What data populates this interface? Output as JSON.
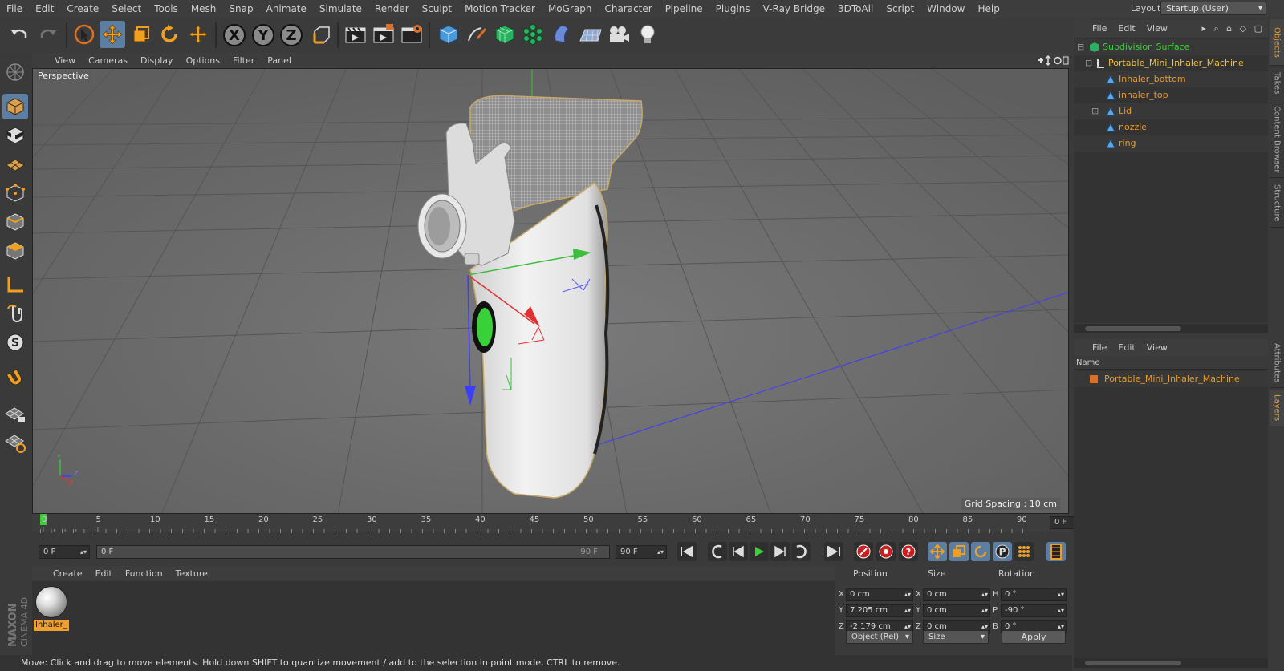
{
  "menubar": {
    "items": [
      "File",
      "Edit",
      "Create",
      "Select",
      "Tools",
      "Mesh",
      "Snap",
      "Animate",
      "Simulate",
      "Render",
      "Sculpt",
      "Motion Tracker",
      "MoGraph",
      "Character",
      "Pipeline",
      "Plugins",
      "V-Ray Bridge",
      "3DToAll",
      "Script",
      "Window",
      "Help"
    ],
    "layout_label": "Layout:",
    "layout_value": "Startup (User)"
  },
  "toolbar": {
    "icons": [
      "undo-icon",
      "redo-icon",
      "live-selection-icon",
      "move-icon",
      "scale-icon",
      "rotate-icon",
      "recent-tool-icon",
      "x-axis-lock",
      "y-axis-lock",
      "z-axis-lock",
      "coordinate-system-icon",
      "render-view-icon",
      "render-picture-viewer-icon",
      "render-settings-icon",
      "cube-primitive-icon",
      "pen-spline-icon",
      "subdivision-surface-icon",
      "cloner-icon",
      "deformer-icon",
      "floor-environment-icon",
      "camera-icon",
      "light-icon"
    ],
    "x_label": "X",
    "y_label": "Y",
    "z_label": "Z"
  },
  "viewport": {
    "menu": [
      "View",
      "Cameras",
      "Display",
      "Options",
      "Filter",
      "Panel"
    ],
    "camera_label": "Perspective",
    "grid_spacing": "Grid Spacing : 10 cm",
    "axis_x": "X",
    "axis_y": "Y",
    "axis_z": "Z"
  },
  "timeline": {
    "ticks": [
      "0",
      "5",
      "10",
      "15",
      "20",
      "25",
      "30",
      "35",
      "40",
      "45",
      "50",
      "55",
      "60",
      "65",
      "70",
      "75",
      "80",
      "85",
      "90"
    ],
    "current_frame": "0 F"
  },
  "transport": {
    "start_field": "0 F",
    "range_start": "0 F",
    "range_end": "90 F",
    "end_field": "90 F"
  },
  "material_manager": {
    "menu": [
      "Create",
      "Edit",
      "Function",
      "Texture"
    ],
    "material_name": "Inhaler_"
  },
  "coordinates": {
    "headers": {
      "position": "Position",
      "size": "Size",
      "rotation": "Rotation"
    },
    "rows": [
      {
        "axis": "X",
        "pos": "0 cm",
        "size_axis": "X",
        "size": "0 cm",
        "rot_axis": "H",
        "rot": "0 °"
      },
      {
        "axis": "Y",
        "pos": "7.205 cm",
        "size_axis": "Y",
        "size": "0 cm",
        "rot_axis": "P",
        "rot": "-90 °"
      },
      {
        "axis": "Z",
        "pos": "-2.179 cm",
        "size_axis": "Z",
        "size": "0 cm",
        "rot_axis": "B",
        "rot": "0 °"
      }
    ],
    "mode_dropdown": "Object (Rel)",
    "size_dropdown": "Size",
    "apply": "Apply"
  },
  "statusbar": {
    "text": "Move: Click and drag to move elements. Hold down SHIFT to quantize movement / add to the selection in point mode, CTRL to remove."
  },
  "object_manager": {
    "menu": [
      "File",
      "Edit",
      "View"
    ],
    "tree": [
      {
        "label": "Subdivision Surface"
      },
      {
        "label": "Portable_Mini_Inhaler_Machine"
      },
      {
        "label": "Inhaler_bottom"
      },
      {
        "label": "inhaler_top"
      },
      {
        "label": "Lid"
      },
      {
        "label": "nozzle"
      },
      {
        "label": "ring"
      }
    ]
  },
  "layers": {
    "menu": [
      "File",
      "Edit",
      "View"
    ],
    "column_name": "Name",
    "item": "Portable_Mini_Inhaler_Machine"
  },
  "side_tabs": [
    "Objects",
    "Takes",
    "Content Browser",
    "Structure",
    "Attributes",
    "Layers"
  ],
  "branding": "MAXON CINEMA 4D",
  "colors": {
    "accent_orange": "#e79a2c",
    "selected_tool": "#5d7ea3"
  }
}
